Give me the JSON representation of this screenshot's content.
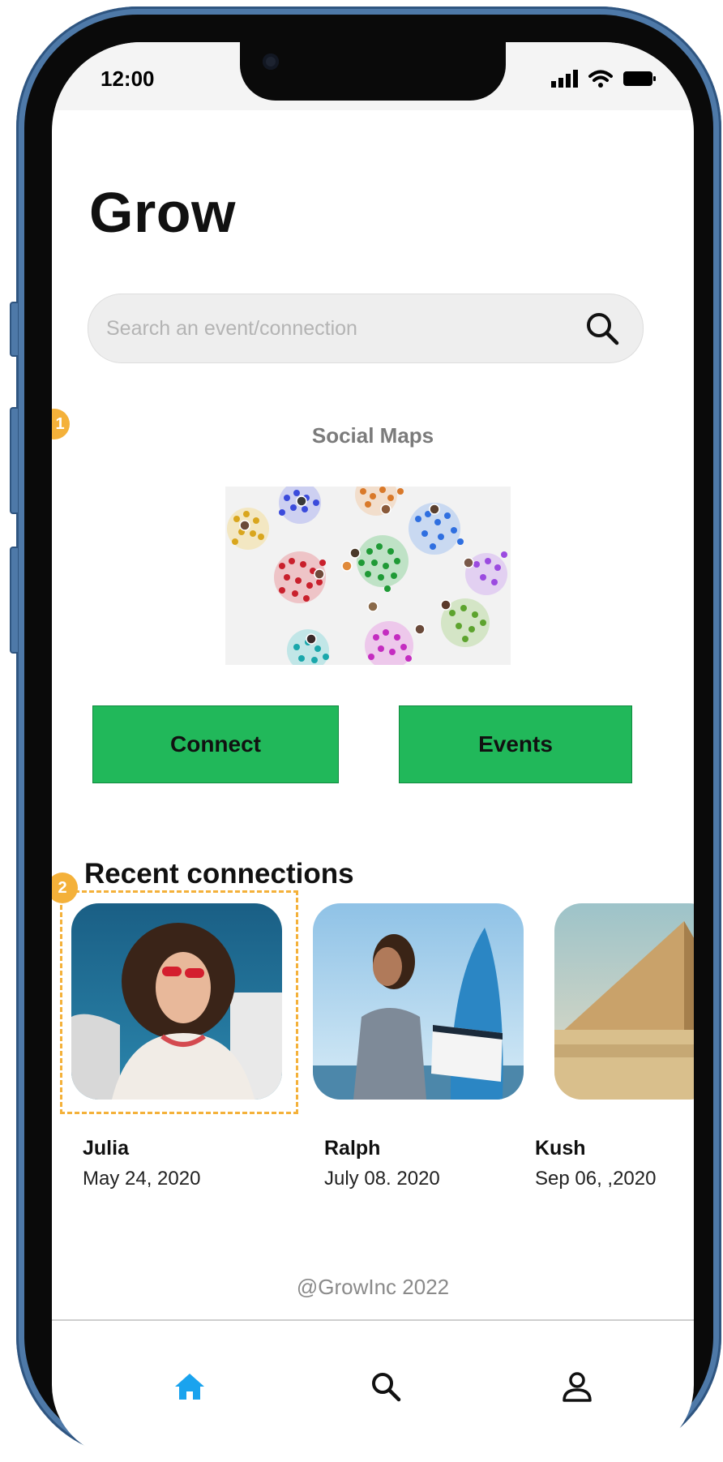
{
  "status": {
    "time": "12:00"
  },
  "app": {
    "title": "Grow"
  },
  "search": {
    "placeholder": "Search an event/connection"
  },
  "annotations": [
    "1",
    "2"
  ],
  "social": {
    "label": "Social Maps"
  },
  "actions": {
    "connect": "Connect",
    "events": "Events"
  },
  "recent": {
    "heading": "Recent connections",
    "items": [
      {
        "name": "Julia",
        "date": "May 24, 2020"
      },
      {
        "name": "Ralph",
        "date": "July 08. 2020"
      },
      {
        "name": "Kush",
        "date": "Sep 06, ,2020"
      }
    ]
  },
  "footer": {
    "text": "@GrowInc 2022"
  },
  "nav": {
    "items": [
      "home-icon",
      "search-icon",
      "profile-icon"
    ],
    "active": "home-icon"
  },
  "colors": {
    "accent": "#21b85a",
    "badge": "#f4b13a",
    "nav_active": "#1aa3ee",
    "frame": "#4e79a8"
  }
}
